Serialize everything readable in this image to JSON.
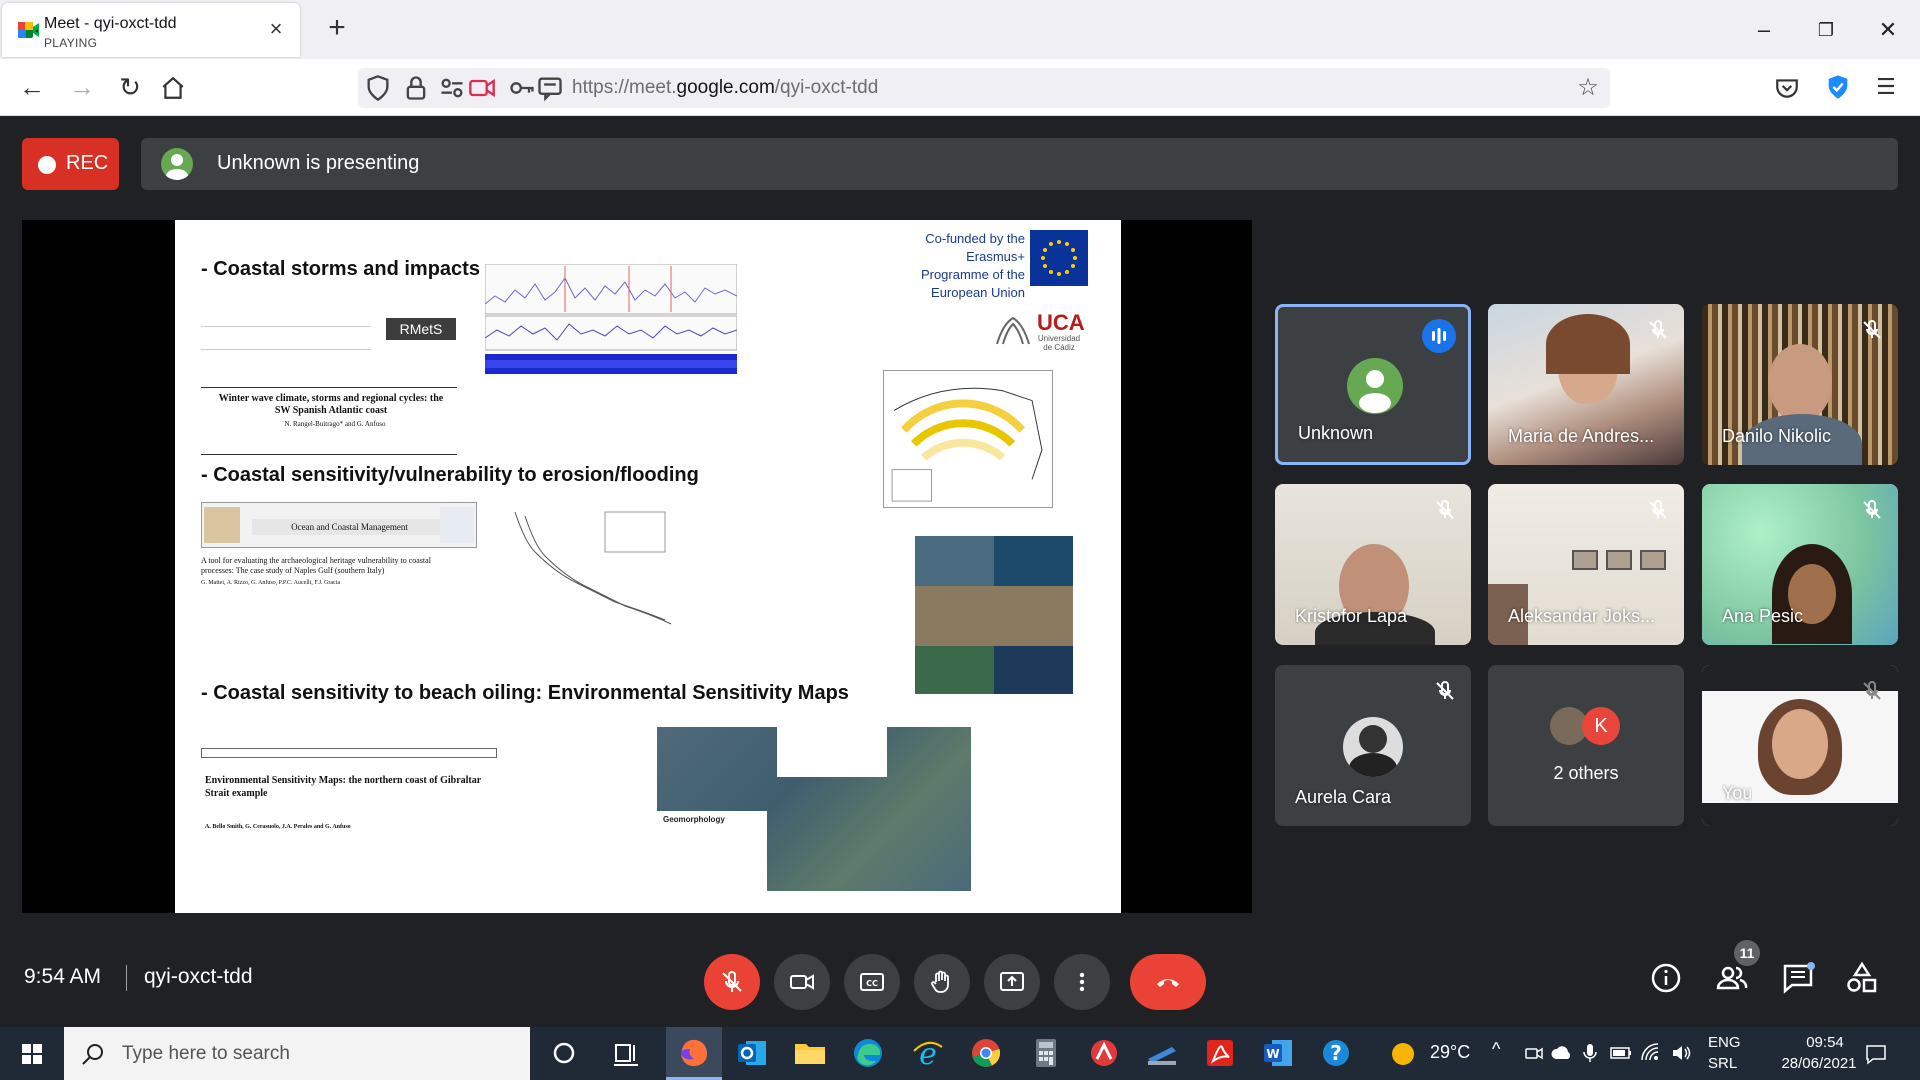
{
  "browser": {
    "tab": {
      "title": "Meet - qyi-oxct-tdd",
      "status": "PLAYING"
    },
    "url": {
      "scheme_host_prefix": "https://meet.",
      "host_main": "google.com",
      "path": "/qyi-oxct-tdd"
    }
  },
  "meet": {
    "rec_label": "REC",
    "presenter_text": "Unknown is presenting",
    "slide": {
      "heading1": "- Coastal storms and impacts",
      "heading2": "- Coastal sensitivity/vulnerability to erosion/flooding",
      "heading3": "- Coastal sensitivity to beach oiling: Environmental Sensitivity Maps",
      "eu_text": "Co-funded by the Erasmus+ Programme of the European Union",
      "uca_logo": "UCA",
      "uca_sub": "Universidad de Cádiz",
      "rmets_logo": "RMetS",
      "paper1_title": "Winter wave climate, storms and regional cycles: the SW Spanish Atlantic coast",
      "paper1_authors": "N. Rangel-Buitrago* and G. Anfuso",
      "journal2": "Ocean and Coastal Management",
      "paper2_title": "A tool for evaluating the archaeological heritage vulnerability to coastal processes: The case study of Naples Gulf (southern Italy)",
      "paper2_authors": "G. Mattei, A. Rizzo, G. Anfuso, P.P.C. Aucelli, F.J. Gracia",
      "paper3_title": "Environmental Sensitivity Maps: the northern coast of Gibraltar Strait example",
      "paper3_authors": "A. Bello Smith, G. Cerasuolo, J.A. Perales and G. Anfuso",
      "map_legend_title": "Geomorphology"
    },
    "participants": [
      {
        "name": "Unknown",
        "speaking": true
      },
      {
        "name": "Maria de Andres...",
        "muted": true
      },
      {
        "name": "Danilo Nikolic",
        "muted": true
      },
      {
        "name": "Kristofor Lapa",
        "muted": true
      },
      {
        "name": "Aleksandar Joks...",
        "muted": true
      },
      {
        "name": "Ana Pesic",
        "muted": true
      },
      {
        "name": "Aurela Cara",
        "muted": true
      },
      {
        "name": "2 others",
        "initial": "K"
      },
      {
        "name": "You",
        "muted": true
      }
    ],
    "bottom": {
      "time": "9:54 AM",
      "meeting_code": "qyi-oxct-tdd",
      "people_count": "11"
    }
  },
  "taskbar": {
    "search_placeholder": "Type here to search",
    "weather": "29°C",
    "lang1": "ENG",
    "lang2": "SRL",
    "time": "09:54",
    "date": "28/06/2021"
  },
  "colors": {
    "rec": "#d93025",
    "end_call": "#ea4335",
    "meet_bg": "#202124",
    "tile_bg": "#3c4043",
    "active_border": "#8ab4f8"
  }
}
